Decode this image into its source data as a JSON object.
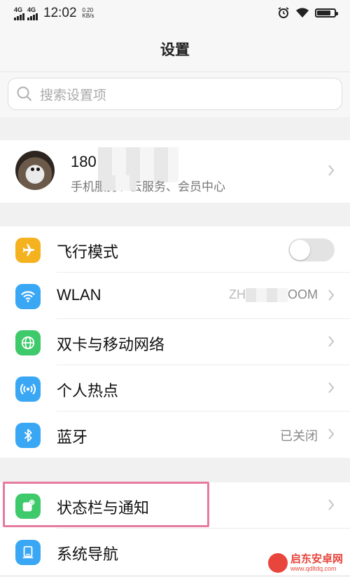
{
  "status_bar": {
    "network1": "4G",
    "network2": "4G",
    "time": "12:02",
    "speed_value": "0.20",
    "speed_unit": "KB/s",
    "battery_level": 0.85
  },
  "header": {
    "title": "设置"
  },
  "search": {
    "placeholder": "搜索设置项"
  },
  "profile": {
    "name_visible": "180",
    "subtitle": "手机服务、云服务、会员中心"
  },
  "rows": [
    {
      "label": "飞行模式",
      "icon": "airplane-icon",
      "color": "#f5b21f",
      "toggle_on": false
    },
    {
      "label": "WLAN",
      "icon": "wifi-icon",
      "color": "#3aa7f5",
      "value_left": "ZH",
      "value_right": "OOM"
    },
    {
      "label": "双卡与移动网络",
      "icon": "globe-icon",
      "color": "#3ec96a"
    },
    {
      "label": "个人热点",
      "icon": "hotspot-icon",
      "color": "#3aa7f5"
    },
    {
      "label": "蓝牙",
      "icon": "bluetooth-icon",
      "color": "#3aa7f5",
      "value": "已关闭"
    },
    {
      "label": "状态栏与通知",
      "icon": "notification-icon",
      "color": "#3ec96a"
    },
    {
      "label": "系统导航",
      "icon": "navigation-icon",
      "color": "#3aa7f5"
    }
  ],
  "highlight_color": "#e77aa0",
  "watermark": {
    "name": "启东安卓网",
    "url": "www.qdltdq.com"
  }
}
